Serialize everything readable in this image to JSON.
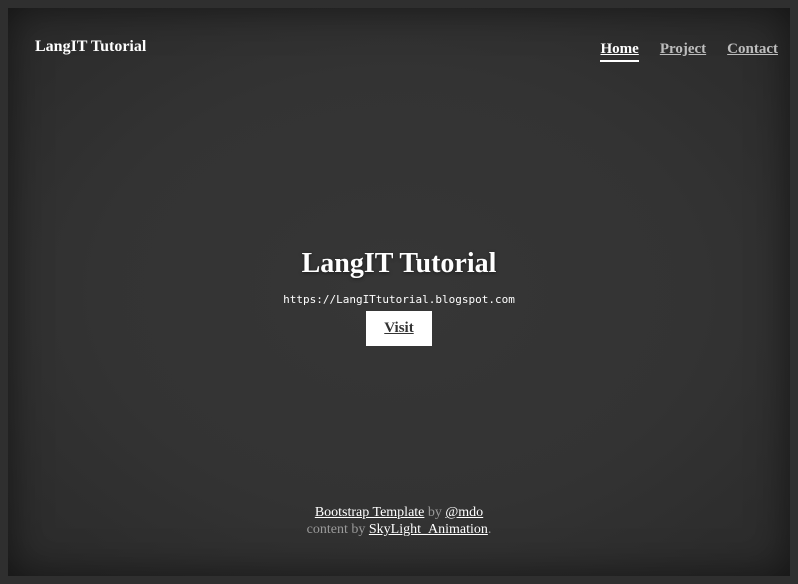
{
  "header": {
    "brand": "LangIT Tutorial",
    "nav": [
      {
        "label": "Home",
        "active": true
      },
      {
        "label": "Project",
        "active": false
      },
      {
        "label": "Contact",
        "active": false
      }
    ]
  },
  "hero": {
    "title": "LangIT Tutorial",
    "url": "https://LangITtutorial.blogspot.com",
    "button_label": "Visit"
  },
  "footer": {
    "template_link": "Bootstrap Template",
    "by_text": " by ",
    "author_link": "@mdo",
    "content_text": "content by ",
    "content_link": "SkyLight_Animation",
    "period": "."
  },
  "colors": {
    "background": "#333333",
    "text": "#ffffff",
    "muted": "#9a9a9a",
    "button_bg": "#ffffff"
  }
}
